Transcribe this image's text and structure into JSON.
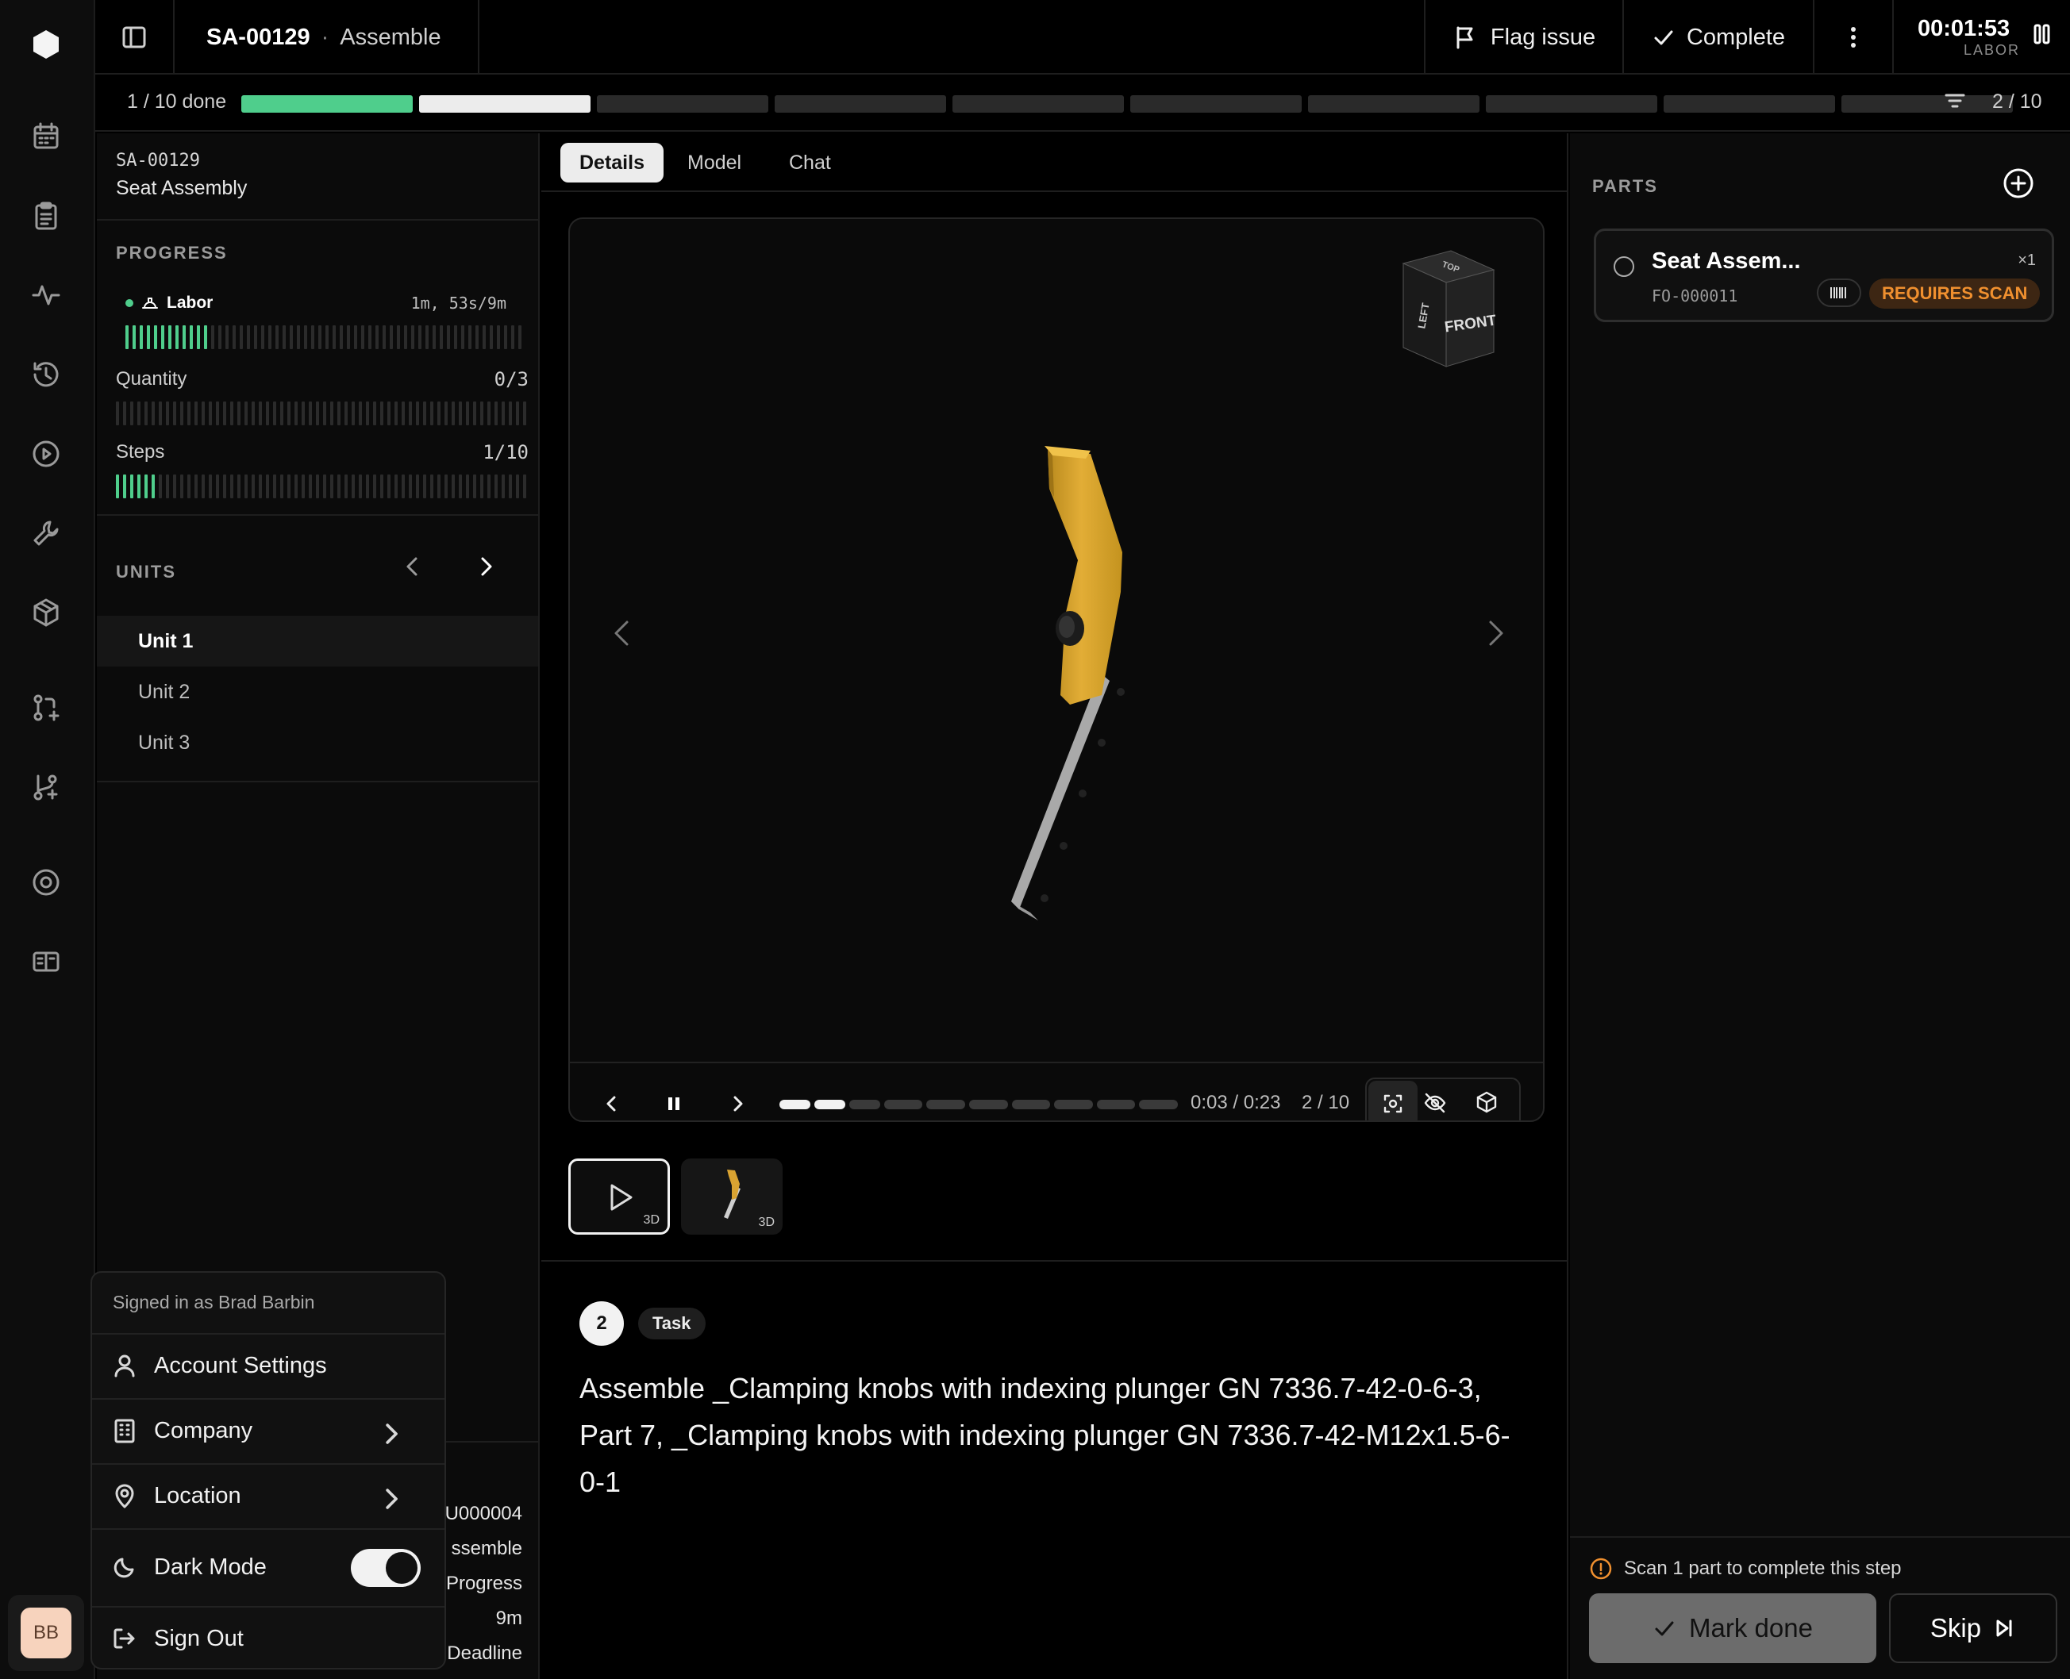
{
  "header": {
    "order_id": "SA-00129",
    "separator": "·",
    "step_name": "Assemble",
    "flag_label": "Flag issue",
    "complete_label": "Complete",
    "timer": "00:01:53",
    "timer_label": "LABOR"
  },
  "progress": {
    "done_text": "1 / 10 done",
    "step_counter": "2 / 10",
    "segments_total": 10,
    "segments_done": 1,
    "current_segment": 2
  },
  "left": {
    "order_id": "SA-00129",
    "order_name": "Seat Assembly",
    "progress_label": "PROGRESS",
    "labor_label": "Labor",
    "labor_value": "1m, 53s/9m",
    "labor_fraction": 0.21,
    "quantity_label": "Quantity",
    "quantity_value": "0/3",
    "quantity_fraction": 0,
    "steps_label": "Steps",
    "steps_value": "1/10",
    "steps_fraction": 0.1,
    "units_label": "UNITS",
    "units": [
      "Unit 1",
      "Unit 2",
      "Unit 3"
    ],
    "active_unit": 0,
    "details": [
      "U000004",
      "ssemble",
      "Progress",
      "9m",
      "Deadline"
    ]
  },
  "tabs": [
    "Details",
    "Model",
    "Chat"
  ],
  "active_tab": 0,
  "viewer": {
    "cube_front": "FRONT",
    "cube_left": "LEFT",
    "cube_top": "TOP",
    "time": "0:03 / 0:23",
    "step": "2 / 10",
    "thumb_badge": "3D",
    "thumb2_badge": "3D"
  },
  "task": {
    "number": "2",
    "badge": "Task",
    "text": "Assemble _Clamping knobs with indexing plunger GN 7336.7-42-0-6-3, Part 7, _Clamping knobs with indexing plunger GN 7336.7-42-M12x1.5-6-0-1"
  },
  "parts": {
    "label": "PARTS",
    "items": [
      {
        "name": "Seat Assem...",
        "code": "FO-000011",
        "qty": "×1",
        "status": "REQUIRES SCAN"
      }
    ]
  },
  "footer": {
    "scan_hint": "Scan 1 part to complete this step",
    "mark_done": "Mark done",
    "skip": "Skip"
  },
  "menu": {
    "signed_in": "Signed in as Brad Barbin",
    "account": "Account Settings",
    "company": "Company",
    "location": "Location",
    "dark_mode": "Dark Mode",
    "dark_mode_on": true,
    "sign_out": "Sign Out"
  },
  "user": {
    "initials": "BB"
  },
  "colors": {
    "accent_green": "#4fce8c",
    "warning_orange": "#f0902f",
    "bg": "#000000"
  }
}
